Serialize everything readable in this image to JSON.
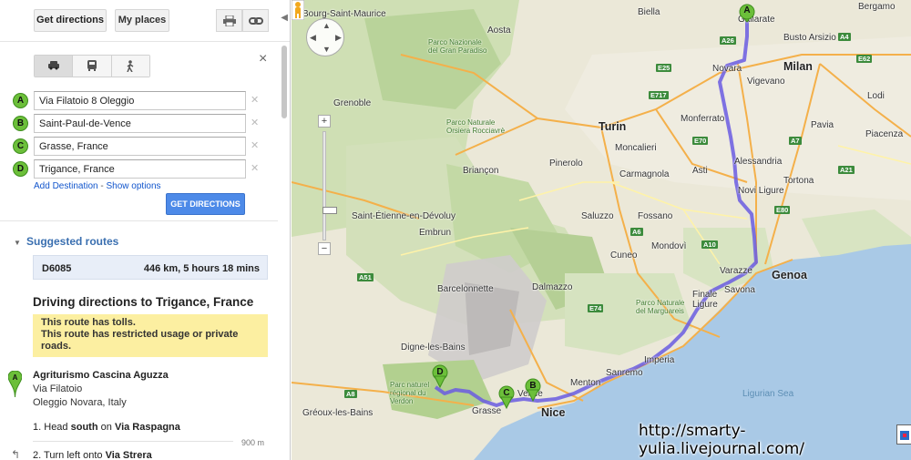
{
  "toolbar": {
    "get_directions": "Get directions",
    "my_places": "My places",
    "print_icon": "print-icon",
    "link_icon": "link-icon"
  },
  "modes": [
    {
      "name": "car-icon",
      "glyph": "🚗"
    },
    {
      "name": "transit-icon",
      "glyph": "🚌"
    },
    {
      "name": "walk-icon",
      "glyph": "🚶"
    }
  ],
  "close": "×",
  "waypoints": [
    {
      "letter": "A",
      "value": "Via Filatoio 8 Oleggio"
    },
    {
      "letter": "B",
      "value": "Saint-Paul-de-Vence"
    },
    {
      "letter": "C",
      "value": "Grasse, France"
    },
    {
      "letter": "D",
      "value": "Trigance, France"
    }
  ],
  "links": {
    "add_destination": "Add Destination",
    "separator": " - ",
    "show_options": "Show options"
  },
  "get_directions_button": "GET DIRECTIONS",
  "suggested": {
    "title": "Suggested routes",
    "route_name": "D6085",
    "route_info": "446 km, 5 hours 18 mins"
  },
  "directions": {
    "title": "Driving directions to Trigance, France",
    "warning_1": "This route has tolls.",
    "warning_2": "This route has restricted usage or private roads.",
    "start_name": "Agriturismo Cascina Aguzza",
    "start_street": "Via Filatoio",
    "start_city": "Oleggio Novara, Italy",
    "step1_num": "1.",
    "step1_pre": "Head",
    "step1_dir": "south",
    "step1_on": "on",
    "step1_road": "Via Raspagna",
    "step1_dist": "900 m",
    "step2_num": "2.",
    "step2_pre": "Turn",
    "step2_dir": "left",
    "step2_onto": "onto",
    "step2_road": "Via Strera"
  },
  "map": {
    "labels": [
      {
        "text": "Bourg-Saint-Maurice",
        "cls": ""
      },
      {
        "text": "Aosta",
        "cls": ""
      },
      {
        "text": "Biella",
        "cls": ""
      },
      {
        "text": "Gallarate",
        "cls": ""
      },
      {
        "text": "Bergamo",
        "cls": ""
      },
      {
        "text": "Busto Arsizio",
        "cls": ""
      },
      {
        "text": "Milan",
        "cls": "big"
      },
      {
        "text": "Novara",
        "cls": ""
      },
      {
        "text": "Vigevano",
        "cls": ""
      },
      {
        "text": "Lodi",
        "cls": ""
      },
      {
        "text": "Pavia",
        "cls": ""
      },
      {
        "text": "Piacenza",
        "cls": ""
      },
      {
        "text": "Turin",
        "cls": "big"
      },
      {
        "text": "Moncalieri",
        "cls": ""
      },
      {
        "text": "Monferrato",
        "cls": ""
      },
      {
        "text": "Alessandria",
        "cls": ""
      },
      {
        "text": "Carmagnola",
        "cls": ""
      },
      {
        "text": "Asti",
        "cls": ""
      },
      {
        "text": "Novi Ligure",
        "cls": ""
      },
      {
        "text": "Tortona",
        "cls": ""
      },
      {
        "text": "Genoa",
        "cls": "big"
      },
      {
        "text": "Savona",
        "cls": ""
      },
      {
        "text": "Varazze",
        "cls": ""
      },
      {
        "text": "Finale Ligure",
        "cls": ""
      },
      {
        "text": "Imperia",
        "cls": ""
      },
      {
        "text": "Sanremo",
        "cls": ""
      },
      {
        "text": "Menton",
        "cls": ""
      },
      {
        "text": "Nice",
        "cls": "big"
      },
      {
        "text": "Grasse",
        "cls": ""
      },
      {
        "text": "Vence",
        "cls": ""
      },
      {
        "text": "Cuneo",
        "cls": ""
      },
      {
        "text": "Mondovì",
        "cls": ""
      },
      {
        "text": "Fossano",
        "cls": ""
      },
      {
        "text": "Saluzzo",
        "cls": ""
      },
      {
        "text": "Pinerolo",
        "cls": ""
      },
      {
        "text": "Briançon",
        "cls": ""
      },
      {
        "text": "Embrun",
        "cls": ""
      },
      {
        "text": "Barcelonnette",
        "cls": ""
      },
      {
        "text": "Dalmazzo",
        "cls": ""
      },
      {
        "text": "Grenoble",
        "cls": ""
      },
      {
        "text": "Saint-Étienne-en-Dévoluy",
        "cls": ""
      },
      {
        "text": "Digne-les-Bains",
        "cls": ""
      },
      {
        "text": "Gréoux-les-Bains",
        "cls": ""
      },
      {
        "text": "Ligurian Sea",
        "cls": "sea"
      },
      {
        "text": "Parco Nazionale del Gran Paradiso",
        "cls": "park"
      },
      {
        "text": "Parco Naturale Orsiera Rocciavrè",
        "cls": "park"
      },
      {
        "text": "Parco Naturale del Marguareis",
        "cls": "park"
      },
      {
        "text": "Parc naturel régional du Verdon",
        "cls": "park"
      }
    ],
    "route_pins": [
      "A",
      "B",
      "C",
      "D"
    ],
    "watermark": "http://smarty-yulia.livejournal.com/",
    "shields": [
      "E25",
      "A26",
      "E62",
      "A7",
      "E70",
      "A6",
      "E74",
      "A51",
      "E80",
      "A8",
      "A10",
      "E717",
      "A21",
      "A4"
    ]
  }
}
